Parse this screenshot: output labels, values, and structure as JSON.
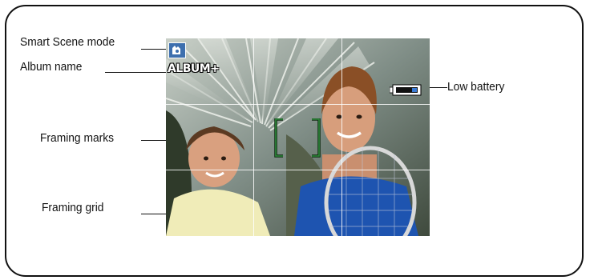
{
  "labels": {
    "smart_scene": "Smart Scene mode",
    "album_name": "Album name",
    "framing_marks": "Framing marks",
    "framing_grid": "Framing grid",
    "low_battery": "Low battery"
  },
  "screen": {
    "album_overlay_text": "ALBUM+"
  },
  "icons": {
    "scene": "smart-scene-icon",
    "battery": "low-battery-icon",
    "marks": "framing-marks-icon"
  },
  "colors": {
    "framing_marks": "#2e8a3a",
    "scene_icon_bg": "#3d6fae",
    "grid": "#ffffff"
  }
}
